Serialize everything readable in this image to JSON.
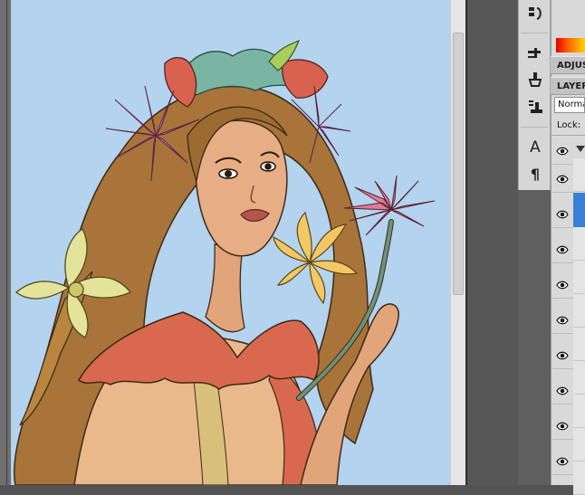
{
  "panels": {
    "adjustments_tab": "ADJUS",
    "layers_tab": "LAYER",
    "blend_mode": "Norma",
    "lock_label": "Lock:"
  },
  "tools": [
    {
      "name": "history-brush-icon"
    },
    {
      "name": "brush-presets-icon"
    },
    {
      "name": "clone-source-icon"
    },
    {
      "name": "tool-presets-icon"
    },
    {
      "name": "character-icon",
      "glyph": "A"
    },
    {
      "name": "paragraph-icon",
      "glyph": "¶"
    }
  ],
  "colors": {
    "canvas_bg": "#b3d3ef",
    "hair": "#a8743a",
    "dress": "#d9694e",
    "selected_layer": "#3a7fd6"
  },
  "layers": {
    "visible_rows": 10,
    "selected_index": 2
  }
}
